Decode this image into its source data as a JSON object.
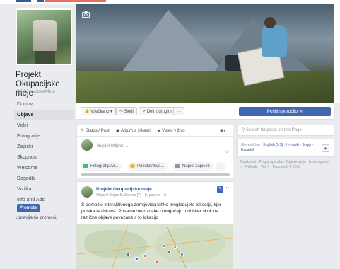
{
  "page": {
    "name": "Projekt Okupacijske meje",
    "handle": "@OkupacijskeMeje"
  },
  "nav": [
    "Domov",
    "Objave",
    "Videi",
    "Fotografije",
    "Zapiski",
    "Skupnost",
    "Welcome",
    "Dogodki",
    "Vizitka",
    "Info and Ads"
  ],
  "promote": {
    "button_label": "Promote",
    "manage_label": "Upravljanje promocij"
  },
  "actions": {
    "liked": "Všečkano",
    "follow": "Sledi",
    "share": "Deli z drugimi",
    "more": "···",
    "send_message": "Pošlji sporočilo"
  },
  "composer": {
    "tabs": [
      "Status / Post",
      "Album s slikami",
      "Video v živo"
    ],
    "placeholder": "Napiši objavo ...",
    "pills": [
      "Fotografija/vi...",
      "Počutje/deja...",
      "Napiši zapisek",
      "···"
    ]
  },
  "post": {
    "author": "Projekt Okupacijske meje",
    "meta": "Objavil Bojan Balkovec [?] · 8. januar · ⊕",
    "body": "S pomočjo interaktivnega zemljevida lahko pregledujete lokacije, kjer poteka raziskava. Posamezne oznake omogočajo tudi hiter skok na različne objave povezane s to lokacijo"
  },
  "sidebar": {
    "search_placeholder": "Search for posts on this Page",
    "lang_label": "Slovenščina · ",
    "lang_links": "English (US) · Hrvatski · Shqip · Español",
    "footer": "Zasebnost · Pogoji uporabe · Oglaševanje · Izbor oglasov ▷ · Piškotki · Več ▾ · Facebook © 2018"
  },
  "colors": {
    "facebook_blue": "#4267b2",
    "link_blue": "#385898",
    "background_gray": "#e9ebee"
  }
}
